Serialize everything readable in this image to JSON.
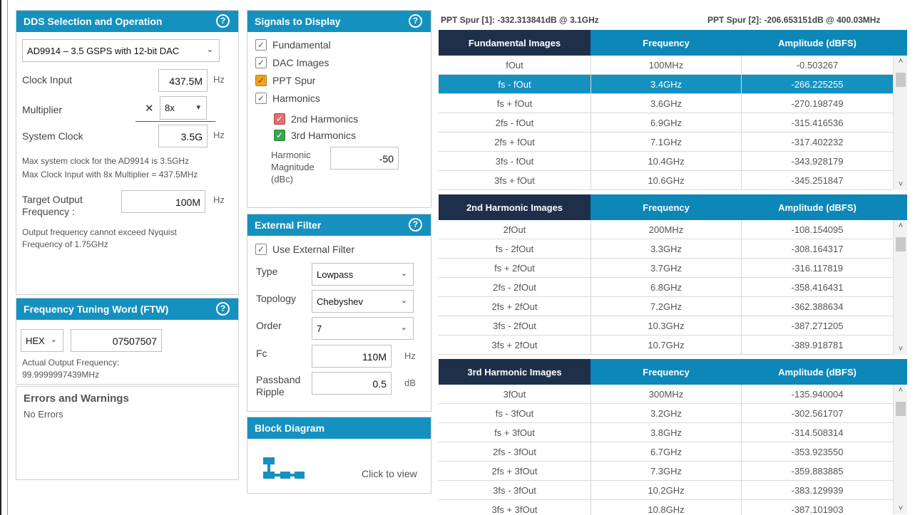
{
  "dds": {
    "title": "DDS Selection and Operation",
    "help": "?",
    "device": "AD9914 – 3.5 GSPS with 12-bit DAC",
    "clock_input_label": "Clock Input",
    "clock_input_value": "437.5M",
    "clock_input_unit": "Hz",
    "multiplier_label": "Multiplier",
    "multiplier_x": "✕",
    "multiplier_value": "8x",
    "system_clock_label": "System Clock",
    "system_clock_value": "3.5G",
    "system_clock_unit": "Hz",
    "note1": "Max system clock for the AD9914 is 3.5GHz",
    "note2": "Max Clock Input with 8x Multiplier = 437.5MHz",
    "target_label_1": "Target Output",
    "target_label_2": "Frequency :",
    "target_value": "100M",
    "target_unit": "Hz",
    "nyq1": "Output frequency cannot exceed Nyquist",
    "nyq2": "Frequency of 1.75GHz"
  },
  "ftw": {
    "title": "Frequency Tuning Word (FTW)",
    "help": "?",
    "format": "HEX",
    "value": "07507507",
    "actual_label": "Actual Output Frequency:",
    "actual_value": "99.9999997439MHz"
  },
  "errors": {
    "title": "Errors and Warnings",
    "text": "No Errors"
  },
  "signals": {
    "title": "Signals to Display",
    "help": "?",
    "fundamental": "Fundamental",
    "dac_images": "DAC Images",
    "ppt_spur": "PPT Spur",
    "harmonics": "Harmonics",
    "h2": "2nd Harmonics",
    "h3": "3rd Harmonics",
    "hm_label_1": "Harmonic",
    "hm_label_2": "Magnitude",
    "hm_label_3": "(dBc)",
    "hm_value": "-50",
    "check": "✓"
  },
  "filter": {
    "title": "External Filter",
    "help": "?",
    "use_label": "Use External Filter",
    "type_label": "Type",
    "type_value": "Lowpass",
    "topology_label": "Topology",
    "topology_value": "Chebyshev",
    "order_label": "Order",
    "order_value": "7",
    "fc_label": "Fc",
    "fc_value": "110M",
    "fc_unit": "Hz",
    "ripple_label_1": "Passband",
    "ripple_label_2": "Ripple",
    "ripple_value": "0.5",
    "ripple_unit": "dB"
  },
  "block": {
    "title": "Block Diagram",
    "click": "Click to view"
  },
  "spur": {
    "spur1": "PPT Spur [1]: -332.313841dB @ 3.1GHz",
    "spur2": "PPT Spur [2]: -206.653151dB @ 400.03MHz"
  },
  "tables": [
    {
      "headers": [
        "Fundamental Images",
        "Frequency",
        "Amplitude (dBFS)"
      ],
      "rows": [
        [
          "fOut",
          "100MHz",
          "-0.503267"
        ],
        [
          "fs - fOut",
          "3.4GHz",
          "-266.225255"
        ],
        [
          "fs + fOut",
          "3.6GHz",
          "-270.198749"
        ],
        [
          "2fs - fOut",
          "6.9GHz",
          "-315.416536"
        ],
        [
          "2fs + fOut",
          "7.1GHz",
          "-317.402232"
        ],
        [
          "3fs - fOut",
          "10.4GHz",
          "-343.928179"
        ],
        [
          "3fs + fOut",
          "10.6GHz",
          "-345.251847"
        ]
      ],
      "selected_row": 1
    },
    {
      "headers": [
        "2nd Harmonic Images",
        "Frequency",
        "Amplitude (dBFS)"
      ],
      "rows": [
        [
          "2fOut",
          "200MHz",
          "-108.154095"
        ],
        [
          "fs - 2fOut",
          "3.3GHz",
          "-308.164317"
        ],
        [
          "fs + 2fOut",
          "3.7GHz",
          "-316.117819"
        ],
        [
          "2fs - 2fOut",
          "6.8GHz",
          "-358.416431"
        ],
        [
          "2fs + 2fOut",
          "7.2GHz",
          "-362.388634"
        ],
        [
          "3fs - 2fOut",
          "10.3GHz",
          "-387.271205"
        ],
        [
          "3fs + 2fOut",
          "10.7GHz",
          "-389.918781"
        ]
      ],
      "selected_row": -1
    },
    {
      "headers": [
        "3rd Harmonic Images",
        "Frequency",
        "Amplitude (dBFS)"
      ],
      "rows": [
        [
          "3fOut",
          "300MHz",
          "-135.940004"
        ],
        [
          "fs - 3fOut",
          "3.2GHz",
          "-302.561707"
        ],
        [
          "fs + 3fOut",
          "3.8GHz",
          "-314.508314"
        ],
        [
          "2fs - 3fOut",
          "6.7GHz",
          "-353.923550"
        ],
        [
          "2fs + 3fOut",
          "7.3GHz",
          "-359.883885"
        ],
        [
          "3fs - 3fOut",
          "10.2GHz",
          "-383.129939"
        ],
        [
          "3fs + 3fOut",
          "10.8GHz",
          "-387.101903"
        ]
      ],
      "selected_row": -1
    }
  ],
  "scroll": {
    "up": "˄",
    "down": "˅"
  }
}
